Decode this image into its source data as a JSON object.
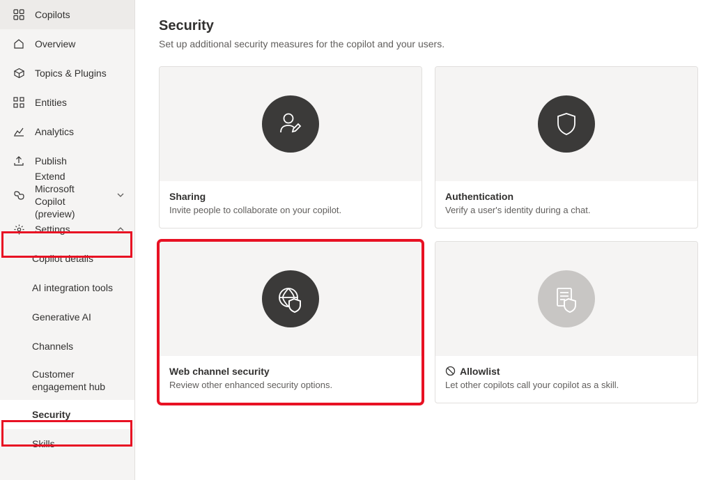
{
  "sidebar": {
    "copilots": "Copilots",
    "items": [
      {
        "label": "Overview"
      },
      {
        "label": "Topics & Plugins"
      },
      {
        "label": "Entities"
      },
      {
        "label": "Analytics"
      },
      {
        "label": "Publish"
      },
      {
        "label": "Extend Microsoft Copilot (preview)"
      },
      {
        "label": "Settings"
      }
    ],
    "sub_items": [
      {
        "label": "Copilot details"
      },
      {
        "label": "AI integration tools"
      },
      {
        "label": "Generative AI"
      },
      {
        "label": "Channels"
      },
      {
        "label": "Customer engagement hub"
      },
      {
        "label": "Security"
      },
      {
        "label": "Skills"
      }
    ]
  },
  "main": {
    "title": "Security",
    "subtitle": "Set up additional security measures for the copilot and your users.",
    "cards": [
      {
        "title": "Sharing",
        "desc": "Invite people to collaborate on your copilot."
      },
      {
        "title": "Authentication",
        "desc": "Verify a user's identity during a chat."
      },
      {
        "title": "Web channel security",
        "desc": "Review other enhanced security options."
      },
      {
        "title": "Allowlist",
        "desc": "Let other copilots call your copilot as a skill."
      }
    ]
  }
}
